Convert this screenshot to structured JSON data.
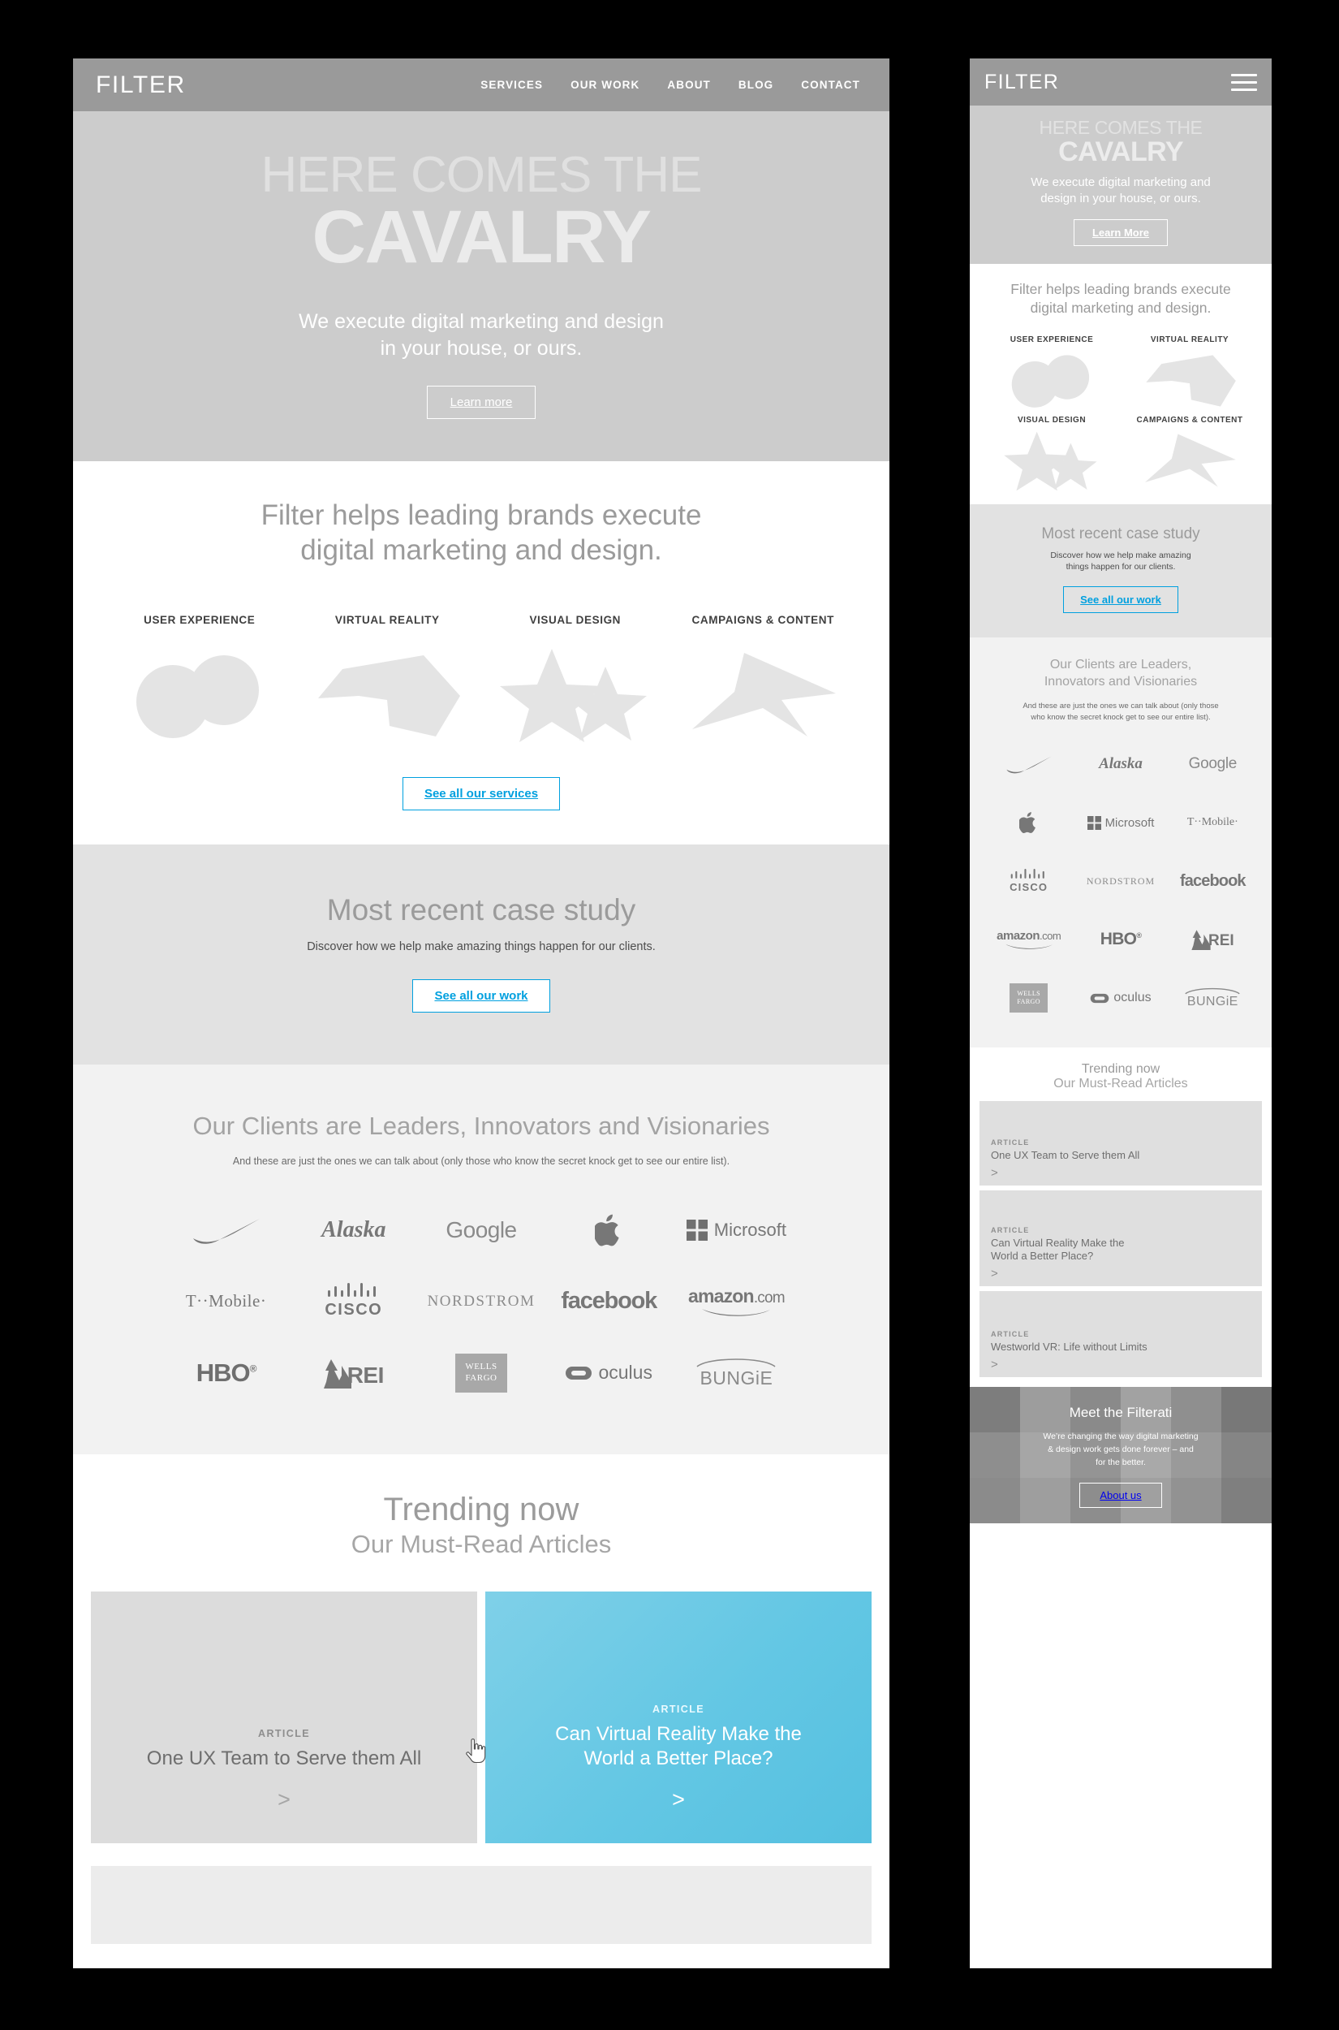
{
  "colors": {
    "accent": "#00a0df",
    "nav_bg": "#9a9a9a",
    "hero_bg": "#cccccc",
    "section_gray": "#e2e2e2",
    "clients_bg": "#f2f2f2"
  },
  "brand": {
    "logo": "FILTER"
  },
  "nav": {
    "items": [
      "SERVICES",
      "OUR WORK",
      "ABOUT",
      "BLOG",
      "CONTACT"
    ]
  },
  "hero": {
    "line1": "HERE COMES THE",
    "line2": "CAVALRY",
    "sub_line1": "We execute digital marketing and design",
    "sub_line2": "in your house, or ours.",
    "sub_mobile_line1": "We execute digital marketing and",
    "sub_mobile_line2": "design in your house, or ours.",
    "cta_desktop": "Learn more",
    "cta_mobile": "Learn More"
  },
  "services": {
    "heading_line1": "Filter helps leading brands execute",
    "heading_line2": "digital marketing and design.",
    "items": [
      {
        "label": "USER EXPERIENCE",
        "art": "circles-shape"
      },
      {
        "label": "VIRTUAL REALITY",
        "art": "polygon-shape"
      },
      {
        "label": "VISUAL DESIGN",
        "art": "stars-shape"
      },
      {
        "label": "CAMPAIGNS & CONTENT",
        "art": "arrow-shape"
      }
    ],
    "cta": "See all our services"
  },
  "case_study": {
    "heading": "Most recent case study",
    "sub": "Discover how we help make amazing things happen for our clients.",
    "sub_mobile_line1": "Discover how we help make amazing",
    "sub_mobile_line2": "things happen for our clients.",
    "cta": "See all our work"
  },
  "clients": {
    "heading": "Our Clients are Leaders, Innovators and Visionaries",
    "heading_mobile_line1": "Our Clients are Leaders,",
    "heading_mobile_line2": "Innovators and Visionaries",
    "sub": "And these are just the ones we can talk about (only those who know the secret knock get to see our entire list).",
    "sub_mobile_line1": "And these are just the ones we can talk about (only those",
    "sub_mobile_line2": "who know the secret knock get to see our entire list).",
    "logos_desktop": [
      "Nike",
      "Alaska",
      "Google",
      "Apple",
      "Microsoft",
      "T··Mobile·",
      "CISCO",
      "NORDSTROM",
      "facebook",
      "amazon.com",
      "HBO",
      "REI",
      "WELLS FARGO",
      "oculus",
      "BUNGiE"
    ],
    "logos_mobile": [
      "Nike",
      "Alaska",
      "Google",
      "Apple",
      "Microsoft",
      "T··Mobile·",
      "CISCO",
      "NORDSTROM",
      "facebook",
      "amazon.com",
      "HBO",
      "REI",
      "WELLS FARGO",
      "oculus",
      "BUNGiE"
    ]
  },
  "trending": {
    "heading": "Trending now",
    "subheading": "Our Must-Read Articles",
    "kicker": "ARTICLE",
    "arrow": ">",
    "cards_desktop": [
      {
        "kicker": "ARTICLE",
        "title": "One UX Team to Serve them All",
        "theme": "gray"
      },
      {
        "kicker": "ARTICLE",
        "title_line1": "Can Virtual Reality Make the",
        "title_line2": "World a Better Place?",
        "theme": "blue"
      }
    ],
    "cards_mobile": [
      {
        "kicker": "ARTICLE",
        "title": "One UX Team to Serve them All"
      },
      {
        "kicker": "ARTICLE",
        "title_line1": "Can Virtual Reality Make the",
        "title_line2": "World a Better Place?"
      },
      {
        "kicker": "ARTICLE",
        "title": "Westworld VR: Life without Limits"
      }
    ]
  },
  "footer": {
    "heading": "Meet the Filterati",
    "line1": "We’re changing the way digital marketing",
    "line2": "& design work gets done forever – and",
    "line3": "for the better.",
    "cta": "About us"
  }
}
